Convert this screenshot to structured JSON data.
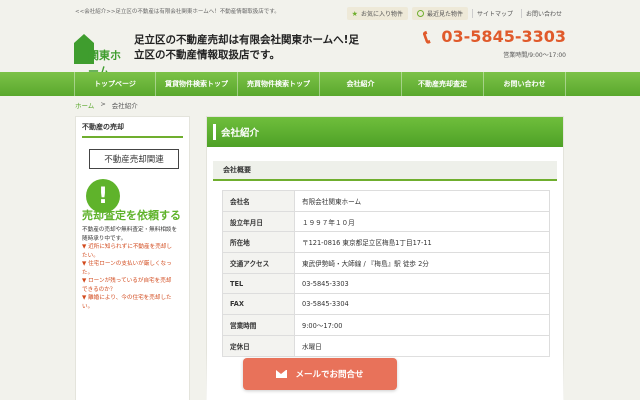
{
  "topbar": {
    "tagline": "<<会社紹介>>足立区の不動産は有限会社関東ホームへ！不動産情報取扱店です。",
    "favorites_label": "お気に入り物件",
    "recent_label": "最近見た物件",
    "sitemap_label": "サイトマップ",
    "contact_label": "お問い合わせ"
  },
  "header": {
    "logo_text": "関東ホーム",
    "site_title": "足立区の不動産売却は有限会社関東ホームへ!足立区の不動産情報取扱店です。",
    "phone": "03-5845-3303",
    "hours": "営業時間/9:00～17:00"
  },
  "nav": {
    "items": [
      "トップページ",
      "賃貸物件検索トップ",
      "売買物件検索トップ",
      "会社紹介",
      "不動産売却査定",
      "お問い合わせ"
    ]
  },
  "breadcrumb": {
    "home": "ホーム",
    "sep": ">",
    "current": "会社紹介"
  },
  "sidebar": {
    "heading": "不動産の売却",
    "button": "不動産売却関連",
    "banner_mark": "!",
    "banner_title": "売却査定を依頼する",
    "lines": [
      "不動産の売却や無料査定・無料相談を",
      "随時承り中です。",
      "▼ 近所に知られずに不動産を売却し",
      "たい。",
      "▼ 住宅ローンの支払いが厳しくなっ",
      "た。",
      "▼ ローンが残っているが自宅を売却",
      "できるのか？",
      "▼ 離婚により、今の住宅を売却した",
      "い。"
    ]
  },
  "main": {
    "heading": "会社紹介",
    "subheading": "会社概要",
    "rows": [
      {
        "k": "会社名",
        "v": "有限会社関東ホーム"
      },
      {
        "k": "設立年月日",
        "v": "１９９７年１０月"
      },
      {
        "k": "所在地",
        "v": "〒121-0816 東京都足立区梅島1丁目17-11"
      },
      {
        "k": "交通アクセス",
        "v": "東武伊勢崎・大師線 / 『梅島』駅 徒歩 2分"
      },
      {
        "k": "TEL",
        "v": "03-5845-3303"
      },
      {
        "k": "FAX",
        "v": "03-5845-3304"
      },
      {
        "k": "営業時間",
        "v": "9:00～17:00"
      },
      {
        "k": "定休日",
        "v": "水曜日"
      }
    ]
  },
  "mail_button": "メールでお問合せ",
  "colors": {
    "accent_green": "#5aa82d",
    "phone_orange": "#e05a2b",
    "mail_button": "#e8725a"
  }
}
